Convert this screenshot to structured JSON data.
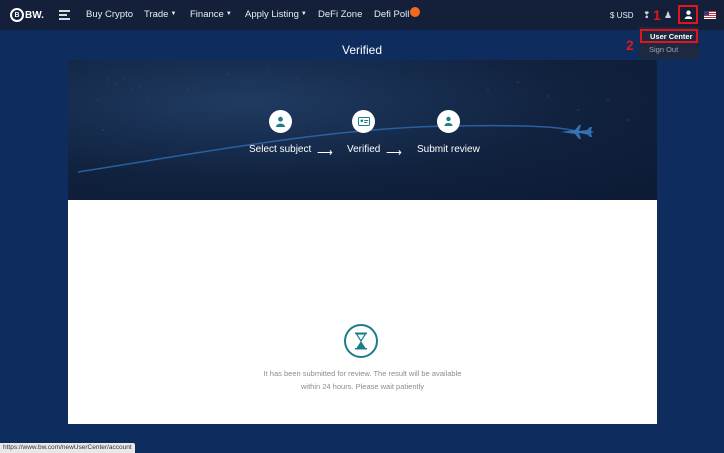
{
  "nav": {
    "logo": "BW.",
    "items": [
      {
        "label": "Buy Crypto"
      },
      {
        "label": "Trade"
      },
      {
        "label": "Finance"
      },
      {
        "label": "Apply Listing"
      },
      {
        "label": "DeFi Zone"
      },
      {
        "label": "Defi Poll"
      }
    ],
    "hot_badge_icon": "hot-badge",
    "currency": "$ USD",
    "markers": {
      "one": "1",
      "two": "2"
    },
    "accent_color": "#e0161b"
  },
  "user_menu": {
    "items": [
      {
        "label": "User Center"
      },
      {
        "label": "Sign Out"
      }
    ]
  },
  "page": {
    "title": "Verified"
  },
  "steps": [
    {
      "label": "Select subject",
      "icon": "person-icon"
    },
    {
      "label": "Verified",
      "icon": "id-card-icon"
    },
    {
      "label": "Submit review",
      "icon": "user-upload-icon"
    }
  ],
  "review": {
    "icon": "hourglass-icon",
    "line1": "It has been submitted for review. The result will be available",
    "line2": "within 24 hours. Please wait patiently"
  },
  "status_bar": {
    "url": "https://www.bw.com/newUserCenter/account"
  },
  "colors": {
    "background": "#0f2c5e",
    "nav": "#14203a",
    "teal": "#1c7c8c"
  }
}
